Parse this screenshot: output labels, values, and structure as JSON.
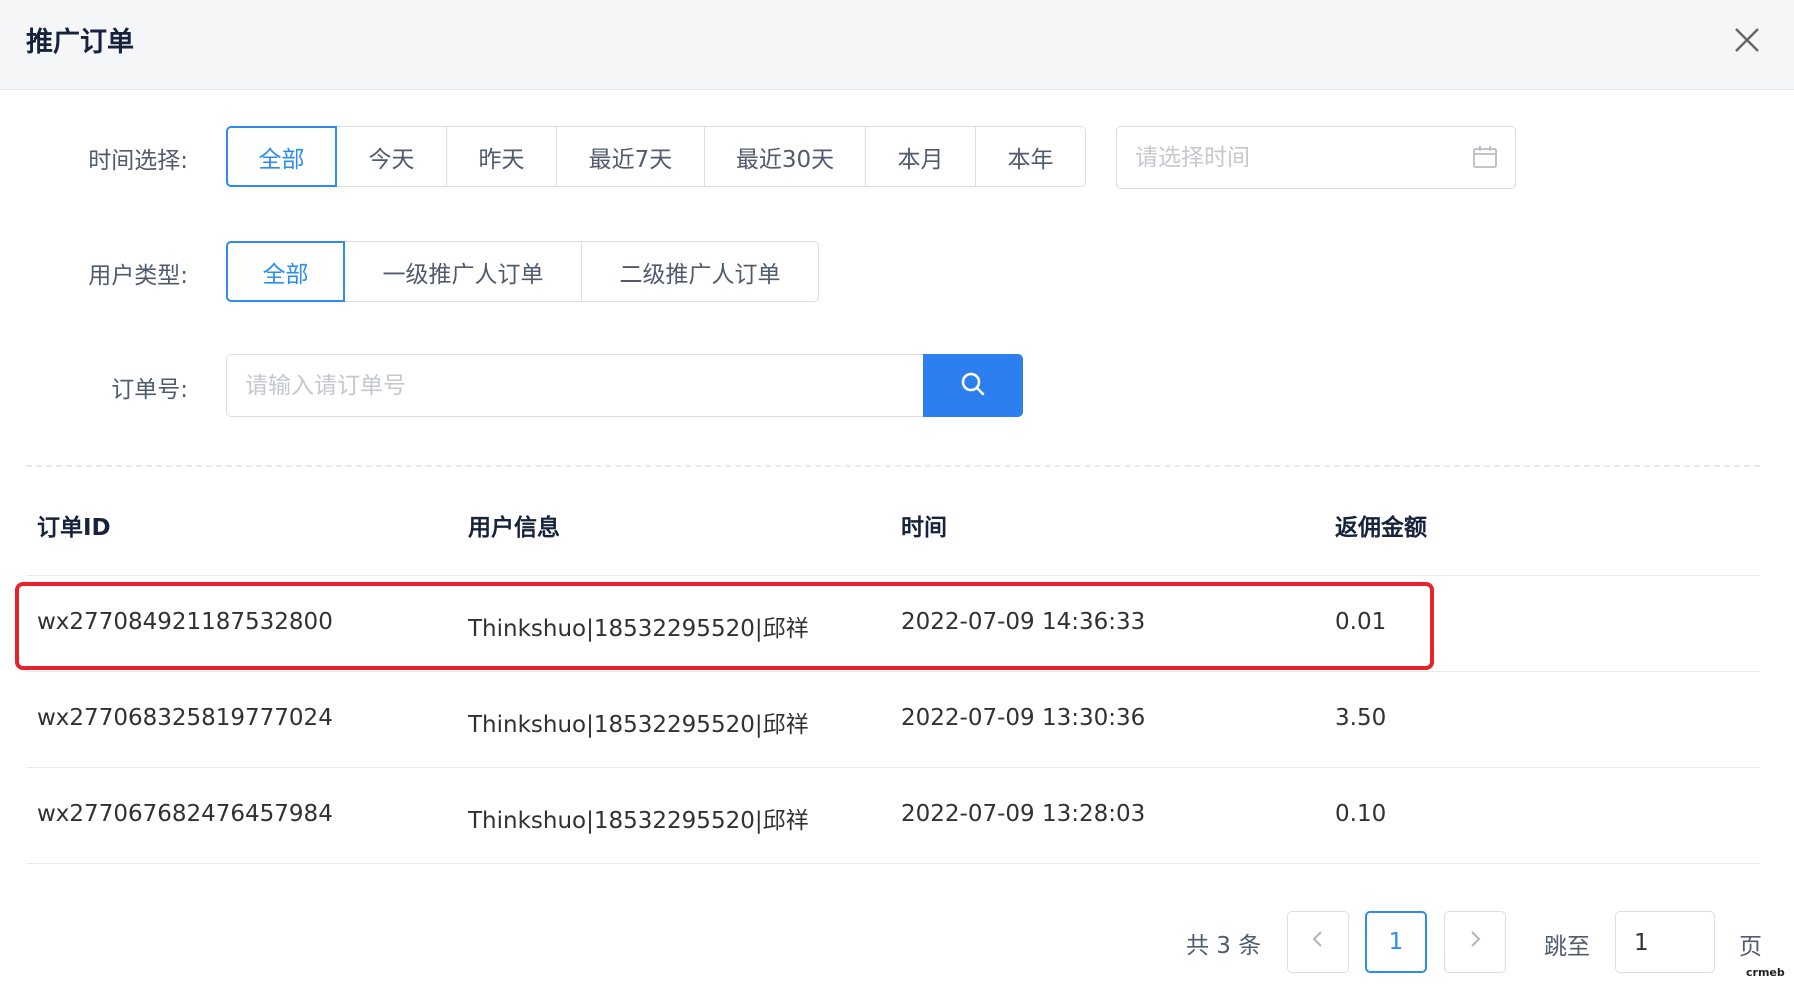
{
  "dialog": {
    "title": "推广订单"
  },
  "filters": {
    "time": {
      "label": "时间选择:",
      "options": [
        "全部",
        "今天",
        "昨天",
        "最近7天",
        "最近30天",
        "本月",
        "本年"
      ],
      "selected": "全部",
      "date_placeholder": "请选择时间"
    },
    "user_type": {
      "label": "用户类型:",
      "options": [
        "全部",
        "一级推广人订单",
        "二级推广人订单"
      ],
      "selected": "全部"
    },
    "order_no": {
      "label": "订单号:",
      "placeholder": "请输入请订单号",
      "value": ""
    }
  },
  "table": {
    "columns": [
      "订单ID",
      "用户信息",
      "时间",
      "返佣金额"
    ],
    "rows": [
      {
        "order_id": "wx277084921187532800",
        "user": "Thinkshuo|18532295520|邱祥",
        "time": "2022-07-09 14:36:33",
        "amount": "0.01"
      },
      {
        "order_id": "wx277068325819777024",
        "user": "Thinkshuo|18532295520|邱祥",
        "time": "2022-07-09 13:30:36",
        "amount": "3.50"
      },
      {
        "order_id": "wx277067682476457984",
        "user": "Thinkshuo|18532295520|邱祥",
        "time": "2022-07-09 13:28:03",
        "amount": "0.10"
      }
    ],
    "highlighted_row": 0
  },
  "pagination": {
    "total_text": "共 3 条",
    "current_page": "1",
    "jump_label": "跳至",
    "jump_value": "1",
    "page_suffix": "页"
  },
  "watermark": "crmeb",
  "colors": {
    "accent": "#2d8cf0",
    "search_button": "#2d7ff0",
    "highlight": "#e8212a"
  }
}
